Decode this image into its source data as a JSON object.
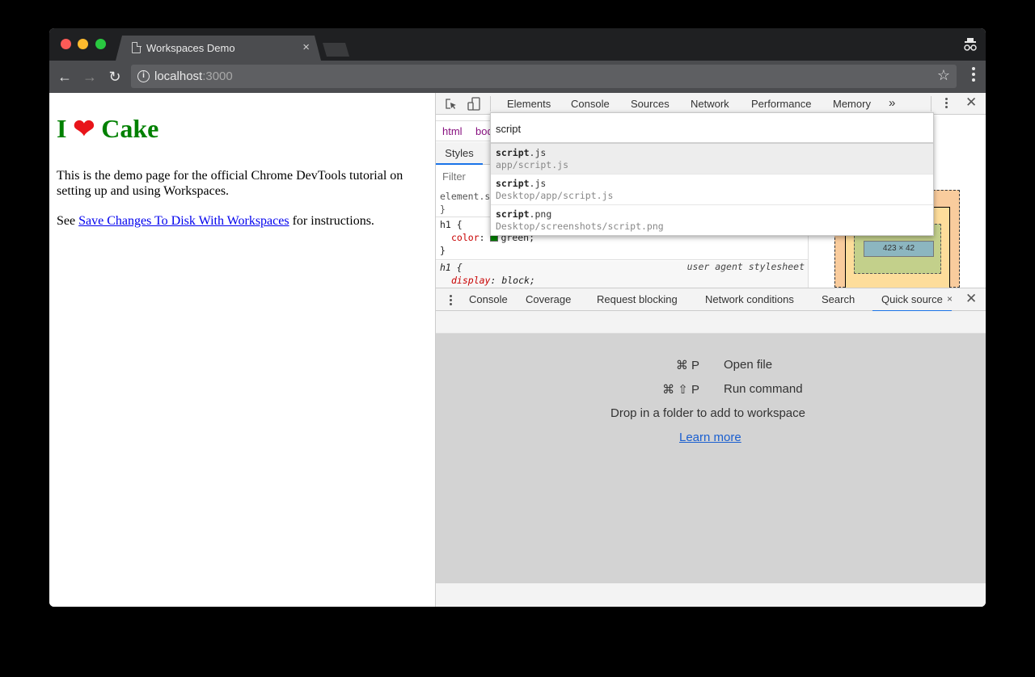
{
  "browser": {
    "tab_title": "Workspaces Demo",
    "tab_close": "×",
    "url_host": "localhost",
    "url_port": ":3000",
    "icons": {
      "back": "←",
      "forward": "→",
      "reload": "↻",
      "info": "i",
      "star": "☆"
    }
  },
  "page": {
    "heading_prefix": "I",
    "heading_heart": "❤",
    "heading_suffix": "Cake",
    "paragraph1": "This is the demo page for the official Chrome DevTools tutorial on setting up and using Workspaces.",
    "paragraph2_prefix": "See ",
    "paragraph2_link": "Save Changes To Disk With Workspaces",
    "paragraph2_suffix": " for instructions.",
    "heading_color": "#008000"
  },
  "devtools": {
    "tabs": [
      "Elements",
      "Console",
      "Sources",
      "Network",
      "Performance",
      "Memory"
    ],
    "more_tabs": "»",
    "close": "✕",
    "breadcrumb": [
      "html",
      "body"
    ],
    "styles_tab": "Styles",
    "filter_placeholder": "Filter",
    "rules": {
      "element_selector": "element.style {",
      "close_brace": "}",
      "h1_selector": "h1 {",
      "color_prop": "color",
      "color_value": "green;",
      "ua_selector": "h1 {",
      "ua_label": "user agent stylesheet",
      "display_prop": "display",
      "display_value": "block;"
    },
    "box_model": {
      "content_size": "423 × 42",
      "dash": "-"
    },
    "quick_open": {
      "query": "script",
      "results": [
        {
          "name_match": "script",
          "name_rest": ".js",
          "path": "app/script.js",
          "selected": true
        },
        {
          "name_match": "script",
          "name_rest": ".js",
          "path": "Desktop/app/script.js",
          "selected": false
        },
        {
          "name_match": "script",
          "name_rest": ".png",
          "path": "Desktop/screenshots/script.png",
          "selected": false
        }
      ]
    },
    "drawer": {
      "tabs": [
        "Console",
        "Coverage",
        "Request blocking",
        "Network conditions",
        "Search",
        "Quick source"
      ],
      "active_tab": "Quick source",
      "tab_close": "×",
      "close": "✕",
      "hints": [
        {
          "keys": "⌘ P",
          "label": "Open file"
        },
        {
          "keys": "⌘ ⇧ P",
          "label": "Run command"
        }
      ],
      "drop_text": "Drop in a folder to add to workspace",
      "learn_more": "Learn more"
    }
  }
}
